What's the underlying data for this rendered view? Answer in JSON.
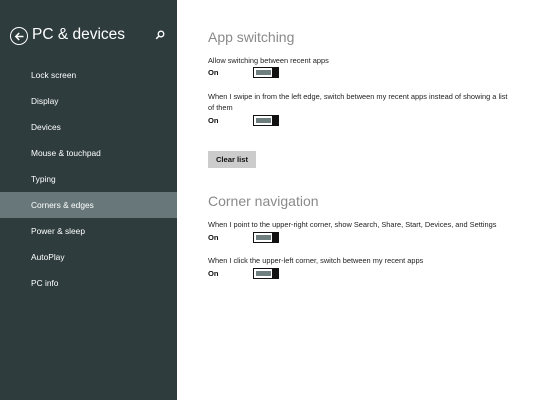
{
  "sidebar": {
    "title": "PC & devices",
    "back_icon": "back-arrow-icon",
    "search_icon": "search-icon",
    "items": [
      {
        "label": "Lock screen"
      },
      {
        "label": "Display"
      },
      {
        "label": "Devices"
      },
      {
        "label": "Mouse & touchpad"
      },
      {
        "label": "Typing"
      },
      {
        "label": "Corners & edges",
        "selected": true
      },
      {
        "label": "Power & sleep"
      },
      {
        "label": "AutoPlay"
      },
      {
        "label": "PC info"
      }
    ]
  },
  "app_switching": {
    "title": "App switching",
    "allow_switching": {
      "label": "Allow switching between recent apps",
      "state": "On"
    },
    "swipe_left": {
      "label": "When I swipe in from the left edge, switch between my recent apps instead of showing a list of them",
      "state": "On"
    },
    "clear_button": "Clear list"
  },
  "corner_navigation": {
    "title": "Corner navigation",
    "upper_right": {
      "label": "When I point to the upper-right corner, show Search, Share, Start, Devices, and Settings",
      "state": "On"
    },
    "upper_left": {
      "label": "When I click the upper-left corner, switch between my recent apps",
      "state": "On"
    }
  },
  "colors": {
    "sidebar_bg": "#2e3c3e",
    "selected_item_bg": "#68787a",
    "toggle_track": "#6f7f80",
    "button_bg": "#cccccc"
  }
}
